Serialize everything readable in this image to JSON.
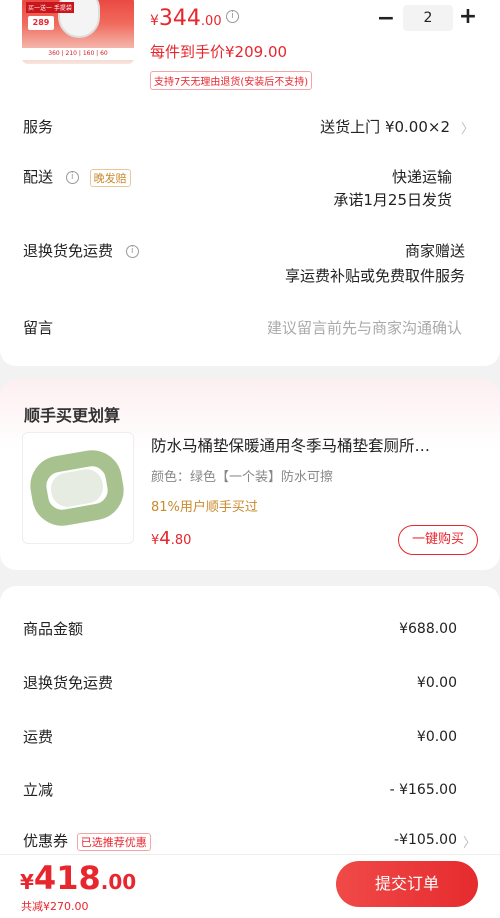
{
  "product": {
    "thumb_tag": "买一送一 手提袋",
    "thumb_badge": "289",
    "thumb_strip": "360 | 210 | 160 | 60",
    "price_currency": "¥",
    "price_int": "344",
    "price_dec": ".00",
    "info_glyph": "i",
    "per_price": "每件到手价¥209.00",
    "return_policy": "支持7天无理由退货(安装后不支持)",
    "quantity": "2",
    "minus": "−",
    "plus": "+"
  },
  "details": {
    "service_label": "服务",
    "service_value": "送货上门  ¥0.00×2",
    "delivery_label": "配送",
    "delivery_tag": "晚发赔",
    "delivery_method": "快递运输",
    "delivery_promise": "承诺1月25日发货",
    "return_label": "退换货免运费",
    "return_value": "商家赠送",
    "return_desc": "享运费补贴或免费取件服务",
    "message_label": "留言",
    "message_placeholder": "建议留言前先与商家沟通确认"
  },
  "addon": {
    "section_title": "顺手买更划算",
    "title": "防水马桶垫保暖通用冬季马桶垫套厕所…",
    "spec": "颜色：绿色【一个装】防水可擦",
    "buyers": "81%用户顺手买过",
    "price_currency": "¥",
    "price_int": "4",
    "price_dec": ".80",
    "buy_button": "一键购买"
  },
  "summary": {
    "goods_label": "商品金额",
    "goods_value": "¥688.00",
    "free_return_label": "退换货免运费",
    "free_return_value": "¥0.00",
    "shipping_label": "运费",
    "shipping_value": "¥0.00",
    "discount_label": "立减",
    "discount_value": "- ¥165.00",
    "coupon_label": "优惠券",
    "coupon_tag": "已选推荐优惠",
    "coupon_value": "-¥105.00"
  },
  "bottom": {
    "total_currency": "¥",
    "total_int": "418",
    "total_dec": ".00",
    "saved": "共减¥270.00",
    "submit_label": "提交订单"
  },
  "chevron": "〉",
  "colors": {
    "accent": "#e8262e",
    "gold": "#c98a2b",
    "background": "#f2f2f2"
  }
}
